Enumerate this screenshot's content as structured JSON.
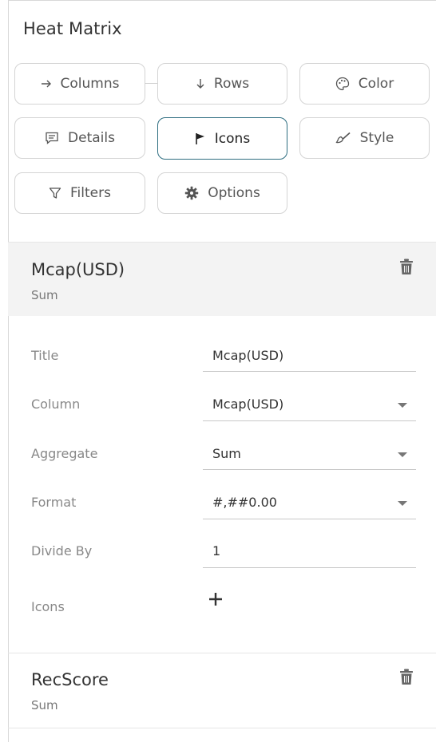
{
  "panel": {
    "title": "Heat Matrix"
  },
  "tabs": {
    "columns": "Columns",
    "rows": "Rows",
    "color": "Color",
    "details": "Details",
    "icons": "Icons",
    "style": "Style",
    "filters": "Filters",
    "options": "Options",
    "active": "Icons"
  },
  "sections": [
    {
      "name": "Mcap(USD)",
      "aggregation": "Sum",
      "fields": {
        "title": {
          "label": "Title",
          "value": "Mcap(USD)"
        },
        "column": {
          "label": "Column",
          "value": "Mcap(USD)"
        },
        "aggregate": {
          "label": "Aggregate",
          "value": "Sum"
        },
        "format": {
          "label": "Format",
          "value": "#,##0.00"
        },
        "divide_by": {
          "label": "Divide By",
          "value": "1"
        },
        "icons": {
          "label": "Icons"
        }
      }
    },
    {
      "name": "RecScore",
      "aggregation": "Sum"
    }
  ],
  "colors": {
    "active_border": "#2d6d80",
    "section_bg": "#f3f3f3"
  }
}
